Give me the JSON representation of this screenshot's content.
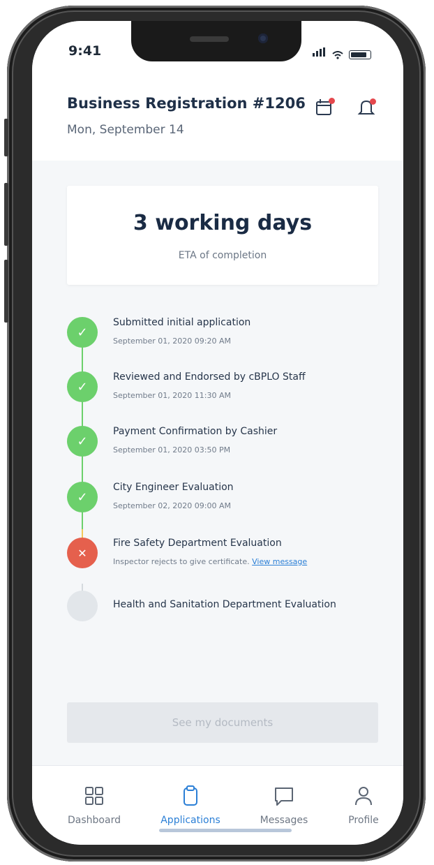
{
  "status_bar": {
    "time": "9:41"
  },
  "header": {
    "title": "Business Registration #1206",
    "date": "Mon, September 14"
  },
  "eta": {
    "value": "3 working days",
    "caption": "ETA of completion"
  },
  "timeline": [
    {
      "title": "Submitted initial application",
      "detail": "September 01, 2020 09:20 AM",
      "status": "done"
    },
    {
      "title": "Reviewed and Endorsed by cBPLO Staff",
      "detail": "September 01, 2020 11:30 AM",
      "status": "done"
    },
    {
      "title": "Payment Confirmation by Cashier",
      "detail": "September 01, 2020 03:50 PM",
      "status": "done"
    },
    {
      "title": "City Engineer Evaluation",
      "detail": "September 02, 2020 09:00 AM",
      "status": "done"
    },
    {
      "title": "Fire Safety Department Evaluation",
      "detail": "Inspector rejects to give certificate.",
      "link": "View message",
      "status": "rejected"
    },
    {
      "title": "Health and Sanitation Department Evaluation",
      "status": "pending"
    }
  ],
  "docs_button": "See my documents",
  "tabs": [
    {
      "label": "Dashboard",
      "icon": "grid-icon"
    },
    {
      "label": "Applications",
      "icon": "clipboard-icon",
      "active": true
    },
    {
      "label": "Messages",
      "icon": "chat-icon"
    },
    {
      "label": "Profile",
      "icon": "user-icon"
    }
  ],
  "colors": {
    "done": "#6cd06c",
    "rejected": "#e5604d",
    "pending": "#e2e6ea",
    "accent": "#2b7fd6"
  }
}
